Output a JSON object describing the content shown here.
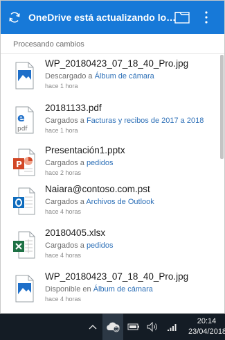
{
  "header": {
    "title": "OneDrive está actualizando los archivos...",
    "sync_icon": "sync-icon",
    "folder_icon": "folder-icon",
    "more_icon": "more-vertical-icon"
  },
  "section": {
    "label": "Procesando cambios"
  },
  "items": [
    {
      "name": "WP_20180423_07_18_40_Pro.jpg",
      "action": "Descargado a",
      "location": "Álbum de cámara",
      "time": "hace 1 hora",
      "icon": "image-file-icon"
    },
    {
      "name": "20181133.pdf",
      "action": "Cargados a",
      "location": "Facturas y recibos de 2017 a 2018",
      "time": "hace 1 hora",
      "icon": "pdf-file-icon"
    },
    {
      "name": "Presentación1.pptx",
      "action": "Cargados a",
      "location": "pedidos",
      "time": "hace 2 horas",
      "icon": "powerpoint-file-icon"
    },
    {
      "name": "Naiara@contoso.com.pst",
      "action": "Cargados a",
      "location": "Archivos de Outlook",
      "time": "hace 4 horas",
      "icon": "outlook-file-icon"
    },
    {
      "name": "20180405.xlsx",
      "action": "Cargados a",
      "location": "pedidos",
      "time": "hace 4 horas",
      "icon": "excel-file-icon"
    },
    {
      "name": "WP_20180423_07_18_40_Pro.jpg",
      "action": "Disponible en",
      "location": "Álbum de cámara",
      "time": "hace 4 horas",
      "icon": "image-file-icon"
    }
  ],
  "taskbar": {
    "time": "20:14",
    "date": "23/04/2018",
    "icons": [
      "chevron-up-icon",
      "onedrive-cloud-icon",
      "battery-icon",
      "volume-icon",
      "wifi-icon"
    ]
  },
  "colors": {
    "header_bg": "#1779d8",
    "link": "#2c6fb7",
    "taskbar_bg": "#141c25",
    "word_pdf_blue": "#1e6fc9",
    "powerpoint": "#d24726",
    "outlook": "#0f6cbd",
    "excel": "#1e7145"
  }
}
